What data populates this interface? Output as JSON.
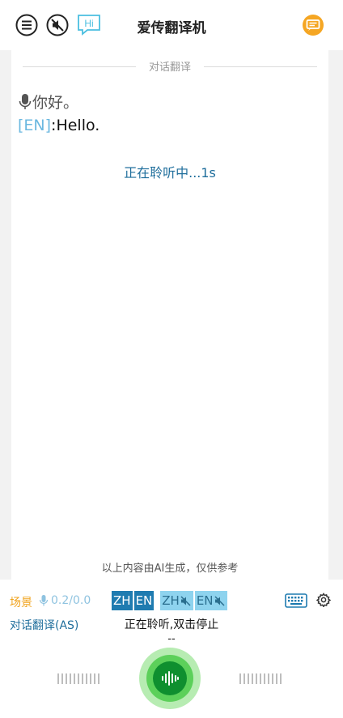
{
  "header": {
    "title": "爱传翻译机",
    "hi_badge": "Hi"
  },
  "conversation": {
    "section_label": "对话翻译",
    "source_text": "你好。",
    "target_tag": "[EN]",
    "target_text": ":Hello.",
    "listening_status": "正在聆听中...1s",
    "disclaimer": "以上内容由AI生成，仅供参考"
  },
  "controls": {
    "scene_label": "场景",
    "mic_level": "0.2/0.0",
    "mode_label": "对话翻译(AS)",
    "lang_chips": [
      "ZH",
      "EN",
      "ZH",
      "EN"
    ],
    "status_text": "正在聆听,双击停止",
    "timer_text": "--"
  },
  "colors": {
    "accent_blue": "#1f7bb0",
    "light_blue": "#8ed3ee",
    "scene_orange": "#f0a21a",
    "mic_green": "#0f8f2f"
  }
}
